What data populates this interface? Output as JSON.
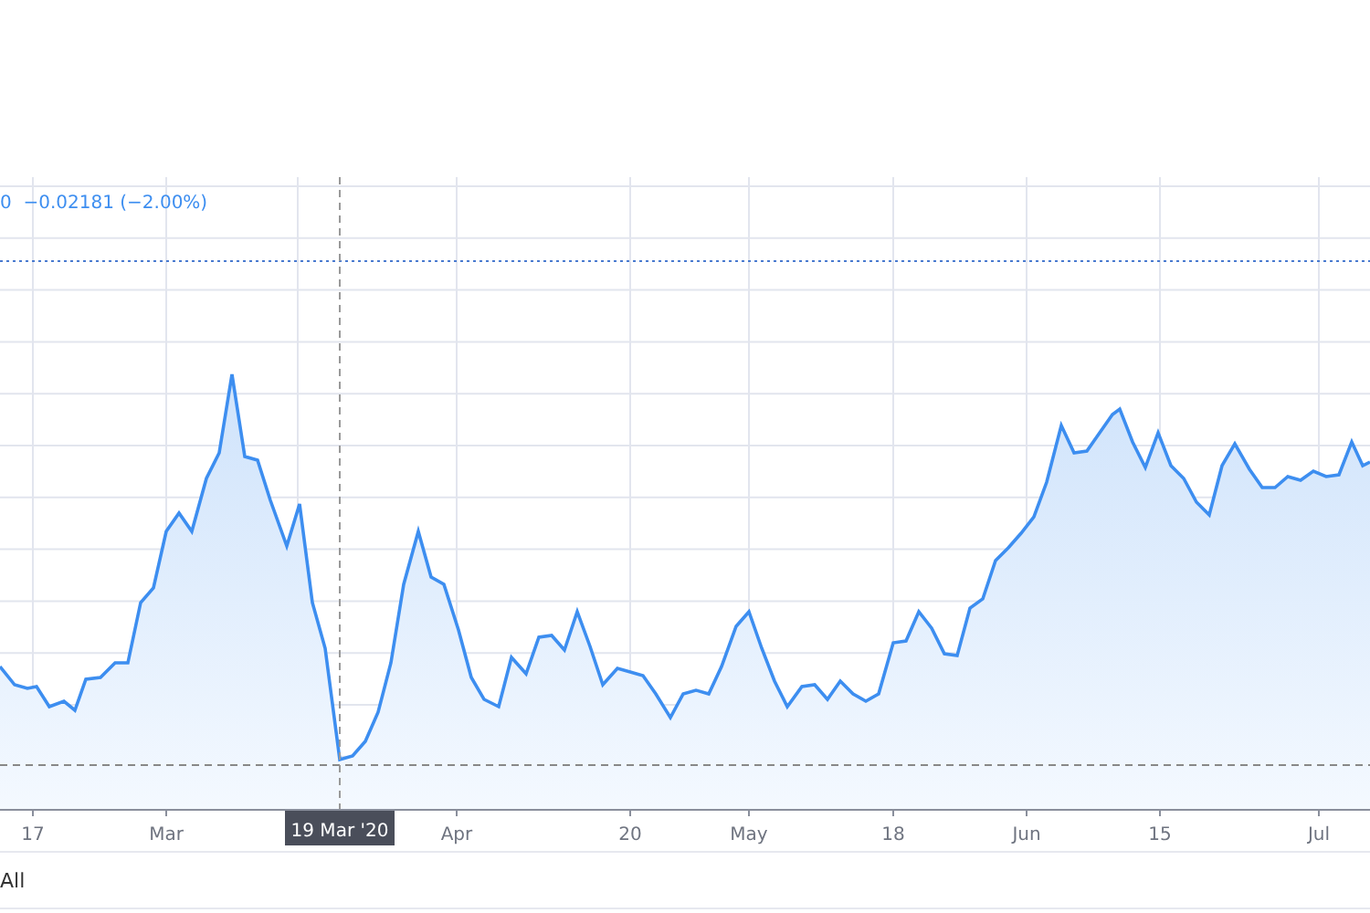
{
  "legend": "0  −0.02181 (−2.00%)",
  "x_axis": {
    "labels": [
      "17",
      "Mar",
      "Apr",
      "20",
      "May",
      "18",
      "Jun",
      "15",
      "Jul"
    ]
  },
  "crosshair": {
    "date": "19 Mar '20"
  },
  "range_buttons": [
    "All"
  ]
}
